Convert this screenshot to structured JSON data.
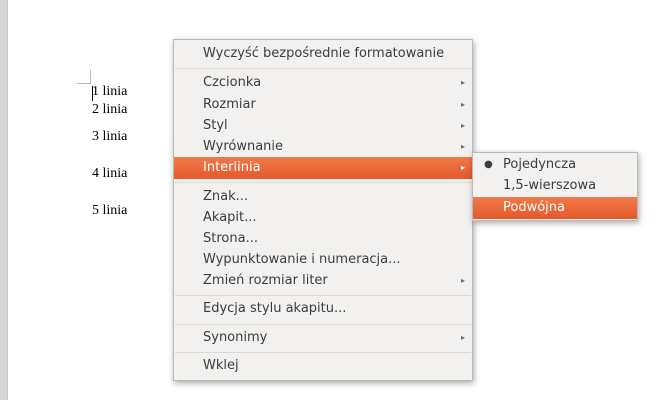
{
  "document": {
    "lines": [
      "1 linia",
      "2 linia",
      "3 linia",
      "4 linia",
      "5 linia"
    ]
  },
  "context_menu": {
    "items": [
      {
        "label": "Wyczyść bezpośrednie formatowanie"
      },
      {
        "label": "Czcionka",
        "has_submenu": true
      },
      {
        "label": "Rozmiar",
        "has_submenu": true
      },
      {
        "label": "Styl",
        "has_submenu": true
      },
      {
        "label": "Wyrównanie",
        "has_submenu": true
      },
      {
        "label": "Interlinia",
        "has_submenu": true,
        "highlighted": true
      },
      {
        "label": "Znak..."
      },
      {
        "label": "Akapit..."
      },
      {
        "label": "Strona..."
      },
      {
        "label": "Wypunktowanie i numeracja..."
      },
      {
        "label": "Zmień rozmiar liter",
        "has_submenu": true
      },
      {
        "label": "Edycja stylu akapitu..."
      },
      {
        "label": "Synonimy",
        "has_submenu": true
      },
      {
        "label": "Wklej"
      }
    ],
    "submenu_arrow": "▸"
  },
  "interlinia_submenu": {
    "items": [
      {
        "label": "Pojedyncza",
        "selected": true
      },
      {
        "label": "1,5-wierszowa"
      },
      {
        "label": "Podwójna",
        "highlighted": true
      }
    ],
    "radio_dot": "●"
  },
  "colors": {
    "highlight": "#e95c2c",
    "menu_bg": "#f2f1f0",
    "menu_text": "#3c3c3c"
  }
}
